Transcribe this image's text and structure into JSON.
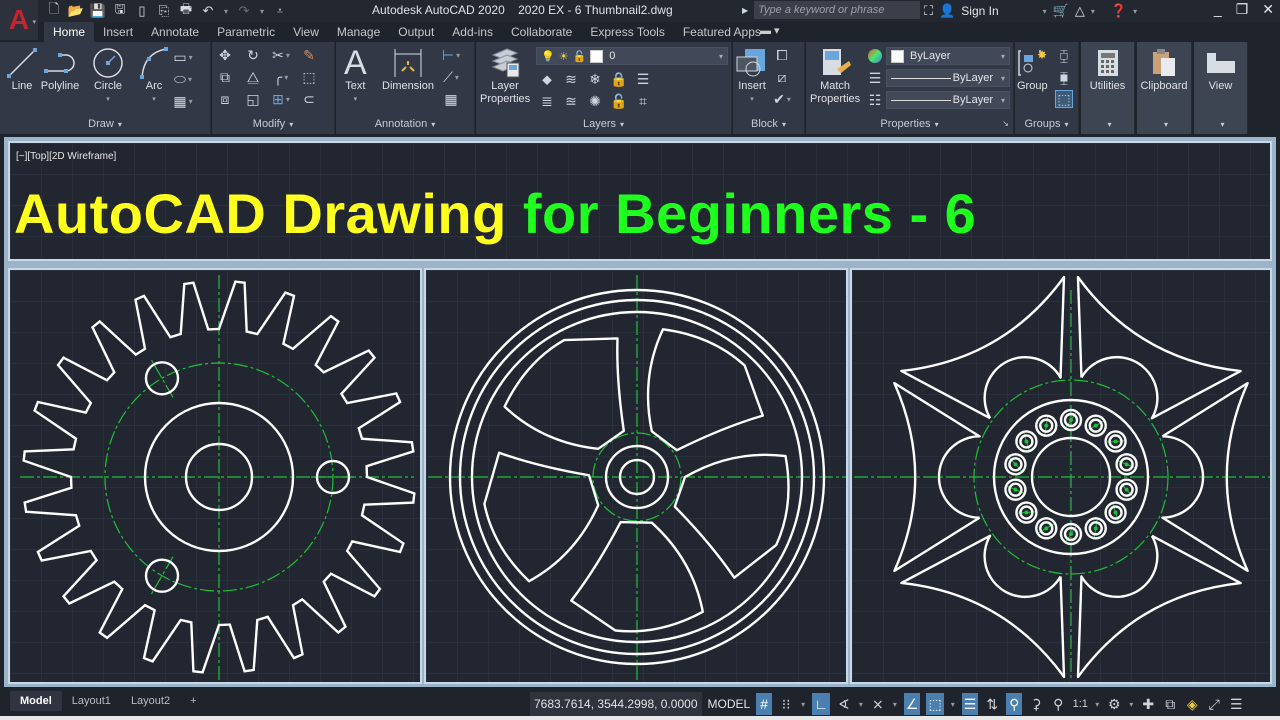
{
  "app": {
    "name": "Autodesk AutoCAD 2020",
    "file": "2020 EX - 6 Thumbnail2.dwg",
    "logo_letter": "A"
  },
  "quick_access": [
    "new-icon",
    "open-icon",
    "save-icon",
    "save-as-icon",
    "open-sheet-icon",
    "publish-icon",
    "plot-icon",
    "undo-icon",
    "redo-icon",
    "customize-icon"
  ],
  "search": {
    "placeholder": "Type a keyword or phrase"
  },
  "account": {
    "sign_in": "Sign In"
  },
  "tabs": [
    {
      "label": "Home",
      "active": true
    },
    {
      "label": "Insert"
    },
    {
      "label": "Annotate"
    },
    {
      "label": "Parametric"
    },
    {
      "label": "View"
    },
    {
      "label": "Manage"
    },
    {
      "label": "Output"
    },
    {
      "label": "Add-ins"
    },
    {
      "label": "Collaborate"
    },
    {
      "label": "Express Tools"
    },
    {
      "label": "Featured Apps"
    }
  ],
  "ribbon": {
    "draw": {
      "title": "Draw",
      "line": "Line",
      "polyline": "Polyline",
      "circle": "Circle",
      "arc": "Arc"
    },
    "modify": {
      "title": "Modify"
    },
    "annotation": {
      "title": "Annotation",
      "text": "Text",
      "dimension": "Dimension"
    },
    "layers": {
      "title": "Layers",
      "layer_properties_1": "Layer",
      "layer_properties_2": "Properties",
      "current_layer": "0"
    },
    "block": {
      "title": "Block",
      "insert": "Insert"
    },
    "properties": {
      "title": "Properties",
      "match_1": "Match",
      "match_2": "Properties",
      "color": "ByLayer",
      "linetype": "ByLayer",
      "lineweight": "ByLayer"
    },
    "groups": {
      "title": "Groups",
      "group": "Group"
    },
    "utilities": {
      "title": "Utilities"
    },
    "clipboard": {
      "title": "Clipboard"
    },
    "view": {
      "title": "View"
    }
  },
  "viewport": {
    "label": "[−][Top][2D Wireframe]",
    "banner_part1": "AutoCAD Drawing",
    "banner_part2": "for Beginners - 6",
    "colors": {
      "yellow": "#ffff1f",
      "green": "#1eff1e",
      "geometry": "#ffffff",
      "centerline": "#1fbf3a"
    }
  },
  "layout_tabs": [
    {
      "label": "Model",
      "active": true
    },
    {
      "label": "Layout1"
    },
    {
      "label": "Layout2"
    },
    {
      "label": "+"
    }
  ],
  "status": {
    "coordinates": "7683.7614, 3544.2998, 0.0000",
    "space": "MODEL",
    "annotation_scale": "1:1"
  }
}
